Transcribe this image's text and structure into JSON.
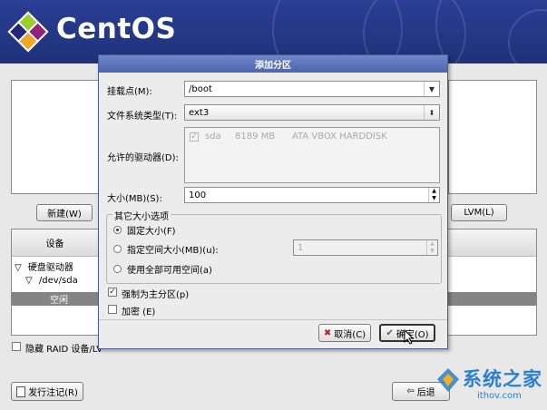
{
  "header": {
    "logo_text": "CentOS"
  },
  "background": {
    "new_button": "新建(W)",
    "lvm_button": "LVM(L)",
    "table_header_device": "设备",
    "tree": {
      "hard_drives": "硬盘驱动器",
      "dev_sda": "/dev/sda",
      "free_space": "空闲"
    },
    "hide_raid_label": "隐藏 RAID 设备/LV",
    "release_notes_button": "发行注记(R)",
    "back_button": "后退"
  },
  "dialog": {
    "title": "添加分区",
    "mount_point_label": "挂载点(M):",
    "mount_point_value": "/boot",
    "fs_type_label": "文件系统类型(T):",
    "fs_type_value": "ext3",
    "drives_label": "允许的驱动器(D):",
    "drive_row": {
      "name": "sda",
      "size": "8189 MB",
      "model": "ATA VBOX HARDDISK"
    },
    "size_label": "大小(MB)(S):",
    "size_value": "100",
    "other_size_group": "其它大小选项",
    "opt_fixed": "固定大小(F)",
    "opt_fill_upto": "指定空间大小(MB)(u):",
    "opt_fill_upto_value": "1",
    "opt_fill_all": "使用全部可用空间(a)",
    "force_primary": "强制为主分区(p)",
    "encrypt": "加密 (E)",
    "cancel_button": "取消(C)",
    "ok_button": "确定(O)"
  },
  "watermark": {
    "text": "系统之家",
    "url_text": "ithov.com"
  },
  "colors": {
    "banner": "#24388a",
    "dialog_title": "#5a71ba",
    "dialog_bg": "#ececec"
  }
}
